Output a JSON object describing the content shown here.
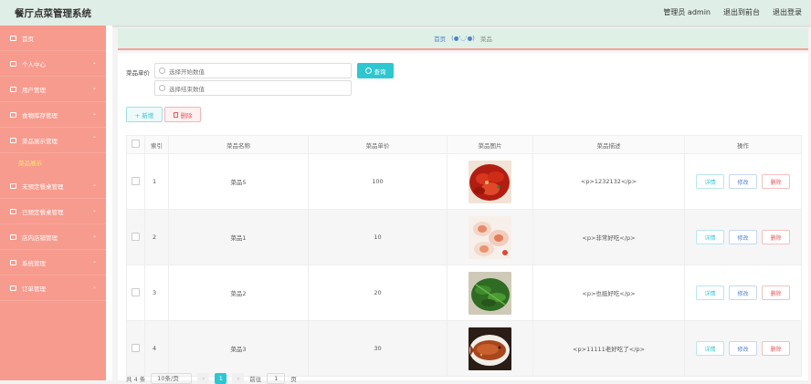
{
  "header": {
    "title": "餐厅点菜管理系统",
    "admin": "管理员 admin",
    "to_front": "退出到前台",
    "logout": "退出登录"
  },
  "sidebar": {
    "items": [
      {
        "label": "首页",
        "icon": "home-icon",
        "chevron": ""
      },
      {
        "label": "个人中心",
        "icon": "user-icon",
        "chevron": "⌄"
      },
      {
        "label": "用户管理",
        "icon": "grid-icon",
        "chevron": "⌄"
      },
      {
        "label": "食物库存管理",
        "icon": "chart-icon",
        "chevron": "⌄"
      },
      {
        "label": "菜品展示管理",
        "icon": "menu-icon",
        "chevron": "⌃"
      },
      {
        "label": "未预定餐桌管理",
        "icon": "table-icon",
        "chevron": "⌄"
      },
      {
        "label": "已预定餐桌管理",
        "icon": "table-icon",
        "chevron": "⌄"
      },
      {
        "label": "店内店铺管理",
        "icon": "shop-icon",
        "chevron": "⌄"
      },
      {
        "label": "系统管理",
        "icon": "settings-icon",
        "chevron": "⌄"
      },
      {
        "label": "订单管理",
        "icon": "order-icon",
        "chevron": "⌄"
      }
    ],
    "sub_item": "菜品展示"
  },
  "breadcrumb": {
    "home": "首页",
    "face": "(●'◡'●)",
    "current": "菜品"
  },
  "filter": {
    "label": "菜品单价",
    "start_placeholder": "选择开始数值",
    "end_placeholder": "选择结束数值",
    "query": "查询"
  },
  "actions": {
    "add": "+ 新增",
    "delete": "删除"
  },
  "table": {
    "headers": [
      "索引",
      "菜品名称",
      "菜品单价",
      "菜品图片",
      "菜品描述",
      "操作"
    ],
    "rows": [
      {
        "index": "1",
        "name": "菜品5",
        "price": "100",
        "image": "crayfish",
        "desc": "<p>1232132</p>"
      },
      {
        "index": "2",
        "name": "菜品1",
        "price": "10",
        "image": "scallops",
        "desc": "<p>非常好吃</p>"
      },
      {
        "index": "3",
        "name": "菜品2",
        "price": "20",
        "image": "greens",
        "desc": "<p>也挺好吃</p>"
      },
      {
        "index": "4",
        "name": "菜品3",
        "price": "30",
        "image": "fish",
        "desc": "<p>11111老好吃了</p>"
      }
    ],
    "ops": {
      "detail": "详情",
      "edit": "修改",
      "remove": "删除"
    }
  },
  "pager": {
    "total": "共 4 条",
    "page_size": "10条/页",
    "current_page": "1",
    "goto": "前往",
    "page_unit": "页"
  }
}
